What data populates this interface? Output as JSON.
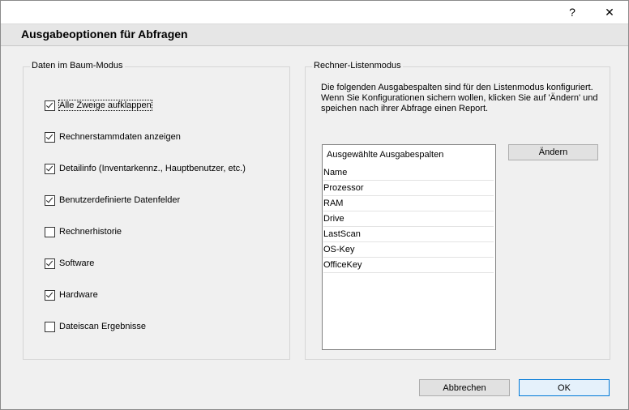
{
  "titlebar": {
    "help_label": "?",
    "close_label": "✕"
  },
  "header": {
    "title": "Ausgabeoptionen für Abfragen"
  },
  "tree_group": {
    "label": "Daten im Baum-Modus",
    "options": [
      {
        "label": "Alle Zweige aufklappen",
        "checked": true
      },
      {
        "label": "Rechnerstammdaten anzeigen",
        "checked": true
      },
      {
        "label": "Detailinfo (Inventarkennz., Hauptbenutzer, etc.)",
        "checked": true
      },
      {
        "label": "Benutzerdefinierte Datenfelder",
        "checked": true
      },
      {
        "label": "Rechnerhistorie",
        "checked": false
      },
      {
        "label": "Software",
        "checked": true
      },
      {
        "label": "Hardware",
        "checked": true
      },
      {
        "label": "Dateiscan Ergebnisse",
        "checked": false
      }
    ]
  },
  "list_group": {
    "label": "Rechner-Listenmodus",
    "info_text": "Die folgenden Ausgabespalten sind für den Listenmodus konfiguriert. Wenn Sie Konfigurationen sichern wollen,  klicken Sie auf 'Ändern' und speichen nach ihrer Abfrage einen Report.",
    "list_header": "Ausgewählte Ausgabespalten",
    "columns": [
      "Name",
      "Prozessor",
      "RAM",
      "Drive",
      "LastScan",
      "OS-Key",
      "OfficeKey"
    ],
    "change_button": "Ändern"
  },
  "footer": {
    "cancel_label": "Abbrechen",
    "ok_label": "OK"
  }
}
